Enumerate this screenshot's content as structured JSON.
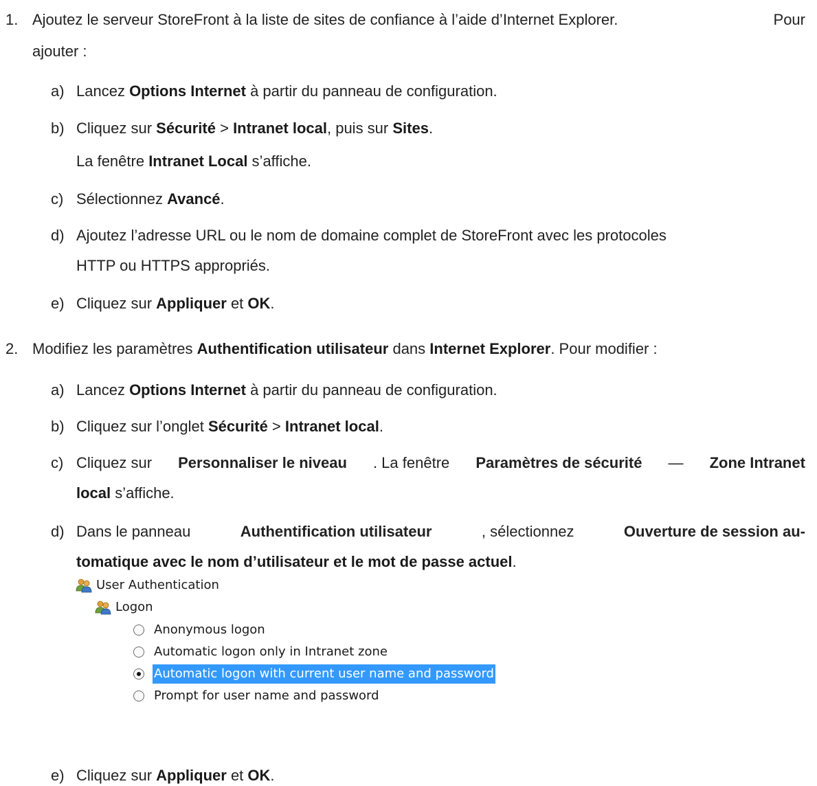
{
  "steps": [
    {
      "number": "1.",
      "text_line1_start": "Ajoutez le serveur StoreFront à la liste de sites de confiance à l’aide d’Internet Explorer.",
      "text_line1_end": "Pour",
      "text_line2": "ajouter :",
      "substeps": [
        {
          "letter": "a)",
          "parts": [
            "Lancez ",
            "Options Internet",
            " à partir du panneau de configuration."
          ]
        },
        {
          "letter": "b)",
          "parts": [
            "Cliquez sur ",
            "Sécurité",
            " > ",
            "Intranet local",
            ", puis sur ",
            "Sites",
            "."
          ],
          "note_parts": [
            "La fenêtre ",
            "Intranet Local",
            " s’affiche."
          ]
        },
        {
          "letter": "c)",
          "parts": [
            "Sélectionnez ",
            "Avancé",
            "."
          ]
        },
        {
          "letter": "d)",
          "line1": "Ajoutez l’adresse URL ou le nom de domaine complet de StoreFront avec les protocoles",
          "line2": "HTTP ou HTTPS appropriés."
        },
        {
          "letter": "e)",
          "parts": [
            "Cliquez sur ",
            "Appliquer",
            " et ",
            "OK",
            "."
          ]
        }
      ]
    },
    {
      "number": "2.",
      "parts": [
        "Modifiez les paramètres ",
        "Authentification utilisateur",
        " dans ",
        "Internet Explorer",
        ". Pour modifier :"
      ],
      "substeps": [
        {
          "letter": "a)",
          "parts": [
            "Lancez ",
            "Options Internet",
            " à partir du panneau de configuration."
          ]
        },
        {
          "letter": "b)",
          "parts": [
            "Cliquez sur l’onglet ",
            "Sécurité",
            " > ",
            "Intranet local",
            "."
          ]
        },
        {
          "letter": "c)",
          "line1_parts": [
            "Cliquez sur ",
            "Personnaliser le niveau",
            ". La fenêtre ",
            "Paramètres de sécurité",
            " —",
            "Zone Intranet"
          ],
          "line2_parts": [
            "local",
            " s’affiche."
          ]
        },
        {
          "letter": "d)",
          "line1_parts": [
            "Dans le panneau ",
            "Authentification utilisateur",
            ", sélectionnez ",
            "Ouverture de session au-"
          ],
          "line2_parts": [
            "tomatique avec le nom d’utilisateur et le mot de passe actuel",
            "."
          ]
        },
        {
          "letter": "e)",
          "parts": [
            "Cliquez sur ",
            "Appliquer",
            " et ",
            "OK",
            "."
          ]
        }
      ]
    }
  ],
  "screenshot": {
    "group_label": "User Authentication",
    "subgroup_label": "Logon",
    "icon": "users-icon",
    "options": [
      {
        "label": "Anonymous logon",
        "selected": false
      },
      {
        "label": "Automatic logon only in Intranet zone",
        "selected": false
      },
      {
        "label": "Automatic logon with current user name and password",
        "selected": true
      },
      {
        "label": "Prompt for user name and password",
        "selected": false
      }
    ],
    "highlight_color": "#3399ff"
  }
}
